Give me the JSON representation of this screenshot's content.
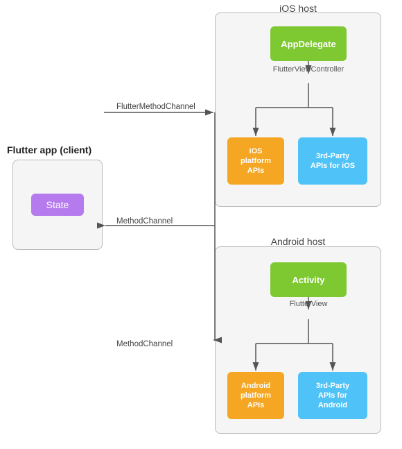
{
  "ios_host": {
    "label": "iOS host"
  },
  "android_host": {
    "label": "Android host"
  },
  "flutter_client": {
    "label": "Flutter app (client)"
  },
  "state_box": {
    "label": "State"
  },
  "app_delegate": {
    "label": "AppDelegate"
  },
  "flutter_view_controller": {
    "label": "FlutterViewController"
  },
  "activity": {
    "label": "Activity"
  },
  "flutter_view": {
    "label": "FlutterView"
  },
  "ios_platform_apis": {
    "line1": "iOS",
    "line2": "platform",
    "line3": "APIs"
  },
  "ios_3rdparty_apis": {
    "line1": "3rd-Party",
    "line2": "APIs for iOS"
  },
  "android_platform_apis": {
    "line1": "Android",
    "line2": "platform",
    "line3": "APIs"
  },
  "android_3rdparty_apis": {
    "line1": "3rd-Party",
    "line2": "APIs for",
    "line3": "Android"
  },
  "channels": {
    "flutter_method_channel": "FlutterMethodChannel",
    "method_channel_1": "MethodChannel",
    "method_channel_2": "MethodChannel"
  }
}
